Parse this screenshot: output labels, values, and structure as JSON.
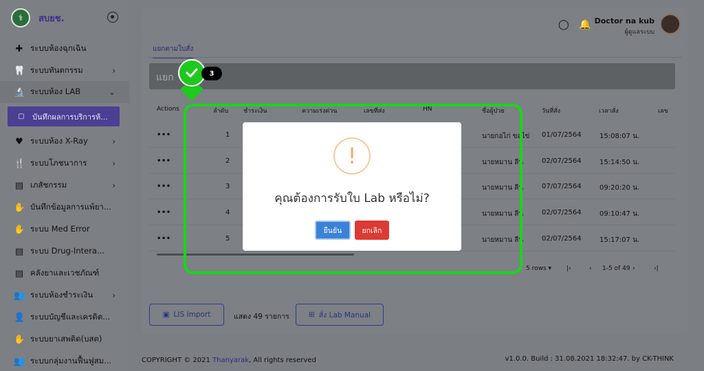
{
  "sidebar": {
    "brand": "สบยช.",
    "items": [
      {
        "label": "ระบบห้องฉุกเฉิน",
        "icon": "plus-icon",
        "glyph": "✚",
        "chevron": false
      },
      {
        "label": "ระบบทันตกรรม",
        "icon": "tooth-icon",
        "glyph": "🦷",
        "chevron": true
      },
      {
        "label": "ระบบห้อง LAB",
        "icon": "microscope-icon",
        "glyph": "🔬",
        "chevron": true,
        "open": true
      },
      {
        "label": "ระบบห้อง X-Ray",
        "icon": "heartbeat-icon",
        "glyph": "♥",
        "chevron": true
      },
      {
        "label": "ระบบโภชนาการ",
        "icon": "nutrition-icon",
        "glyph": "🍴",
        "chevron": true
      },
      {
        "label": "เภสัชกรรม",
        "icon": "document-icon",
        "glyph": "▤",
        "chevron": true
      },
      {
        "label": "บันทึกข้อมูลการแพ้ยา...",
        "icon": "hand-heart-icon",
        "glyph": "✋",
        "chevron": false
      },
      {
        "label": "ระบบ Med Error",
        "icon": "hand-heart-icon",
        "glyph": "✋",
        "chevron": false
      },
      {
        "label": "ระบบ Drug-Intera...",
        "icon": "document-icon",
        "glyph": "▤",
        "chevron": false
      },
      {
        "label": "คลังยาและเวชภัณฑ์",
        "icon": "document-icon",
        "glyph": "▤",
        "chevron": false
      },
      {
        "label": "ระบบห้องชำระเงิน",
        "icon": "people-icon",
        "glyph": "👥",
        "chevron": true
      },
      {
        "label": "ระบบบัญชีและเครดิต...",
        "icon": "person-icon",
        "glyph": "👤",
        "chevron": false
      },
      {
        "label": "ระบบยาเสพติด(บสต)",
        "icon": "hand-heart-icon",
        "glyph": "✋",
        "chevron": false
      },
      {
        "label": "ระบบกลุ่มงานฟื้นฟูสม...",
        "icon": "people-icon",
        "glyph": "👥",
        "chevron": false
      }
    ],
    "sub_item": "บันทึกผลการบริการห้..."
  },
  "header": {
    "user_name": "Doctor na kub",
    "user_role": "ผู้ดูแลระบบ"
  },
  "main": {
    "tab": "แยกตามใบสั่ง",
    "grey_bar_text": "แยก",
    "columns": [
      "Actions",
      "ลำดับ",
      "ชำระเงิน",
      "ความเร่งด่วน",
      "เลขที่ส่ง",
      "HN",
      "ชื่อผู้ป่วย",
      "วันที่สั่ง",
      "เวลาสั่ง",
      "เลข"
    ],
    "rows": [
      {
        "actions": "•••",
        "no": "1",
        "patient": "นายกอไก่ ขอไข่",
        "date": "01/07/2564",
        "time": "15:08:07 น."
      },
      {
        "actions": "•••",
        "no": "2",
        "patient": "นายหมาน ลีน",
        "date": "02/07/2564",
        "time": "15:14:50 น."
      },
      {
        "actions": "•••",
        "no": "3",
        "patient": "นายหมาน ลีน",
        "date": "07/07/2564",
        "time": "09:20:20 น."
      },
      {
        "actions": "•••",
        "no": "4",
        "patient": "นายหมาน ลีน",
        "date": "02/07/2564",
        "time": "09:10:47 น."
      },
      {
        "actions": "•••",
        "no": "5",
        "patient": "นายหมาน ลีน",
        "date": "02/07/2564",
        "time": "15:17:07 น."
      }
    ],
    "pager": {
      "rows_label": "5 rows",
      "range": "1-5 of 49"
    },
    "lis_button": "LIS Import",
    "total_text": "แสดง 49 รายการ",
    "manual_button": "สั่ง Lab Manual"
  },
  "footer": {
    "copyright_prefix": "COPYRIGHT © 2021 ",
    "company": "Thanyarak",
    "copyright_suffix": ", All rights reserved",
    "version": "v1.0.0. Build : 31.08.2021 18:32:47. by CK-THINK"
  },
  "annotation": {
    "step": "3",
    "color": "#1ad51a"
  },
  "modal": {
    "icon_glyph": "!",
    "question": "คุณต้องการรับใบ Lab หรือไม่?",
    "confirm": "ยืนยัน",
    "cancel": "ยกเลิก"
  }
}
